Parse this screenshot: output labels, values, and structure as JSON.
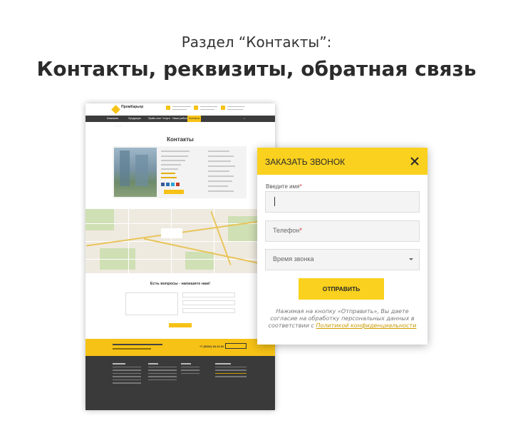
{
  "heading": {
    "subtitle": "Раздел “Контакты”:",
    "title": "Контакты, реквизиты, обратная связь"
  },
  "mock": {
    "logo": "ПромКарьер",
    "nav": [
      "Компания",
      "Продукция",
      "Прайс-лист",
      "Услуги",
      "Наши работы",
      "Контакты"
    ],
    "page_title": "Контакты",
    "question_title": "Есть вопросы - напишите нам!",
    "phone": "+7 (8362) 38-10-00"
  },
  "modal": {
    "title": "ЗАКАЗАТЬ ЗВОНОК",
    "name_label": "Введите имя",
    "phone_placeholder": "Телефон",
    "time_placeholder": "Время звонка",
    "submit_label": "ОТПРАВИТЬ",
    "consent_text": "Нажимая на кнопку «Отправить», Вы даете согласие на обработку персональных данных в соответствии с",
    "consent_link": "Политикой конфиденциальности"
  },
  "colors": {
    "accent": "#f9d11e",
    "dark": "#3a3a3a",
    "required": "#e02020"
  }
}
